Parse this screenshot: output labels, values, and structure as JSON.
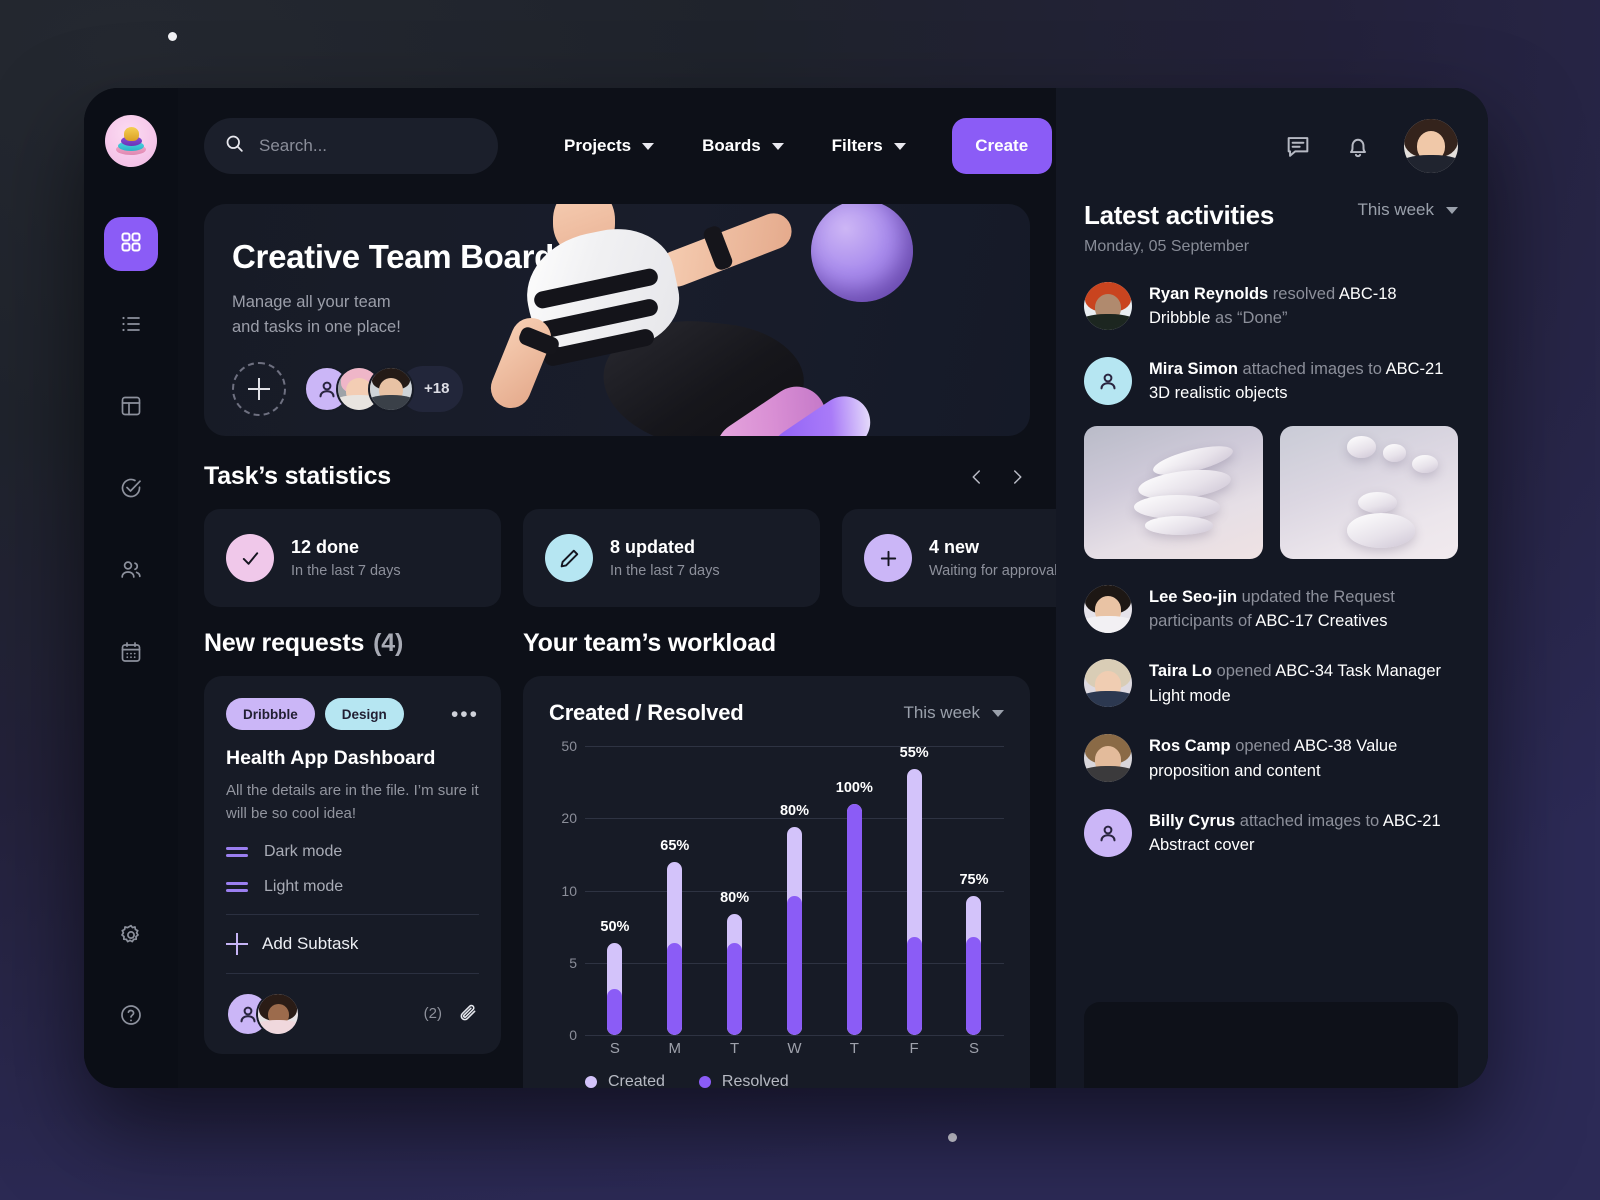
{
  "brand": {
    "logo_name": "stacked-rings-logo",
    "accent": "#8b5cf6"
  },
  "sidebar": {
    "items": [
      {
        "name": "dashboard",
        "icon": "grid-icon",
        "active": true
      },
      {
        "name": "list",
        "icon": "list-icon",
        "active": false
      },
      {
        "name": "board",
        "icon": "layout-icon",
        "active": false
      },
      {
        "name": "tasks",
        "icon": "check-circle-icon",
        "active": false
      },
      {
        "name": "team",
        "icon": "people-icon",
        "active": false
      },
      {
        "name": "calendar",
        "icon": "calendar-icon",
        "active": false
      }
    ],
    "bottom": [
      {
        "name": "settings",
        "icon": "gear-icon"
      },
      {
        "name": "help",
        "icon": "help-circle-icon"
      }
    ]
  },
  "topbar": {
    "search_placeholder": "Search...",
    "search_value": "",
    "menus": [
      {
        "label": "Projects"
      },
      {
        "label": "Boards"
      },
      {
        "label": "Filters"
      }
    ],
    "create_label": "Create"
  },
  "hero": {
    "title": "Creative Team Board",
    "subtitle": "Manage all your team\nand tasks in one place!",
    "subtitle_line1": "Manage all your team",
    "subtitle_line2": "and tasks in one place!",
    "star_icon": "star-icon",
    "add_member_label": "+",
    "extra_members": "+18"
  },
  "stats": {
    "title": "Task’s statistics",
    "cards": [
      {
        "value": "12 done",
        "sub": "In the last 7 days",
        "icon": "check-icon",
        "color": "#f0c8ea"
      },
      {
        "value": "8 updated",
        "sub": "In the last 7 days",
        "icon": "pencil-icon",
        "color": "#b6e6f2"
      },
      {
        "value": "4 new",
        "sub": "Waiting for approval",
        "icon": "plus-icon",
        "color": "#cbb6f7"
      }
    ]
  },
  "requests": {
    "title": "New requests",
    "count": "(4)",
    "card": {
      "tags": [
        {
          "label": "Dribbble",
          "color": "#cbb6f7"
        },
        {
          "label": "Design",
          "color": "#b6e6f2"
        }
      ],
      "menu_icon": "more-horizontal-icon",
      "title": "Health App Dashboard",
      "description": "All the details are in the file. I’m sure it will be so cool idea!",
      "subtasks": [
        "Dark mode",
        "Light mode"
      ],
      "add_subtask_label": "Add Subtask",
      "attachment_count": "(2)",
      "attachment_icon": "paperclip-icon"
    }
  },
  "workload": {
    "title": "Your team’s workload",
    "period": "This week"
  },
  "chart_data": {
    "type": "bar",
    "title": "Created / Resolved",
    "subtitle": "This week",
    "categories": [
      "S",
      "M",
      "T",
      "W",
      "T",
      "F",
      "S"
    ],
    "series": [
      {
        "name": "Created",
        "color": "#d3c3fa",
        "values": [
          8,
          15,
          10.5,
          18,
          20,
          23,
          12
        ]
      },
      {
        "name": "Resolved",
        "color": "#8b5cf6",
        "values": [
          4,
          8,
          8,
          12,
          20,
          8.5,
          8.5
        ]
      }
    ],
    "data_labels": [
      "50%",
      "65%",
      "80%",
      "80%",
      "100%",
      "55%",
      "75%"
    ],
    "ylabel": "",
    "xlabel": "",
    "yticks": [
      "50",
      "20",
      "10",
      "5",
      "0"
    ],
    "ytick_positions": [
      100,
      75,
      50,
      25,
      0
    ],
    "ylim": [
      0,
      25
    ],
    "grid": true,
    "legend_position": "bottom-left",
    "legend": [
      "Created",
      "Resolved"
    ]
  },
  "activities": {
    "title": "Latest activities",
    "date": "Monday, 05 September",
    "period": "This week",
    "items": [
      {
        "avatar": "ryan-avatar",
        "name": "Ryan Reynolds",
        "action": " resolved ",
        "target": "ABC-18 Dribbble",
        "tail": " as “Done”"
      },
      {
        "avatar": "placeholder-avatar-blue",
        "name": "Mira Simon",
        "action": " attached images to ",
        "target": "ABC-21 3D realistic objects",
        "tail": ""
      },
      {
        "avatar": "lee-avatar",
        "name": "Lee Seo-jin",
        "action": " updated the Request participants of ",
        "target": "ABC-17 Creatives",
        "tail": ""
      },
      {
        "avatar": "taira-avatar",
        "name": "Taira Lo",
        "action": " opened ",
        "target": "ABC-34 Task Manager Light mode",
        "tail": ""
      },
      {
        "avatar": "ros-avatar",
        "name": "Ros Camp",
        "action": " opened ",
        "target": "ABC-38 Value proposition and content",
        "tail": ""
      },
      {
        "avatar": "placeholder-avatar-purple",
        "name": "Billy Cyrus",
        "action": " attached images to ",
        "target": "ABC-21 Abstract cover",
        "tail": ""
      }
    ],
    "thumbnails": [
      "3d-stacked-discs",
      "3d-floating-pebbles"
    ]
  },
  "header_icons": [
    {
      "name": "messages-icon"
    },
    {
      "name": "notifications-icon"
    },
    {
      "name": "profile-avatar"
    }
  ]
}
